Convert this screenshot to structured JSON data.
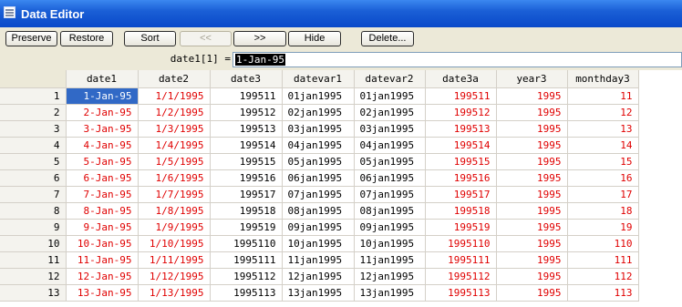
{
  "window": {
    "title": "Data Editor"
  },
  "toolbar": {
    "preserve": "Preserve",
    "restore": "Restore",
    "sort": "Sort",
    "prev": "<<",
    "next": ">>",
    "hide": "Hide",
    "delete": "Delete..."
  },
  "expression": {
    "label": "date1[1] =",
    "value": "1-Jan-95"
  },
  "columns": [
    "date1",
    "date2",
    "date3",
    "datevar1",
    "datevar2",
    "date3a",
    "year3",
    "monthday3"
  ],
  "rows": [
    {
      "n": "1",
      "c": [
        "1-Jan-95",
        "1/1/1995",
        "199511",
        "01jan1995",
        "01jan1995",
        "199511",
        "1995",
        "11"
      ]
    },
    {
      "n": "2",
      "c": [
        "2-Jan-95",
        "1/2/1995",
        "199512",
        "02jan1995",
        "02jan1995",
        "199512",
        "1995",
        "12"
      ]
    },
    {
      "n": "3",
      "c": [
        "3-Jan-95",
        "1/3/1995",
        "199513",
        "03jan1995",
        "03jan1995",
        "199513",
        "1995",
        "13"
      ]
    },
    {
      "n": "4",
      "c": [
        "4-Jan-95",
        "1/4/1995",
        "199514",
        "04jan1995",
        "04jan1995",
        "199514",
        "1995",
        "14"
      ]
    },
    {
      "n": "5",
      "c": [
        "5-Jan-95",
        "1/5/1995",
        "199515",
        "05jan1995",
        "05jan1995",
        "199515",
        "1995",
        "15"
      ]
    },
    {
      "n": "6",
      "c": [
        "6-Jan-95",
        "1/6/1995",
        "199516",
        "06jan1995",
        "06jan1995",
        "199516",
        "1995",
        "16"
      ]
    },
    {
      "n": "7",
      "c": [
        "7-Jan-95",
        "1/7/1995",
        "199517",
        "07jan1995",
        "07jan1995",
        "199517",
        "1995",
        "17"
      ]
    },
    {
      "n": "8",
      "c": [
        "8-Jan-95",
        "1/8/1995",
        "199518",
        "08jan1995",
        "08jan1995",
        "199518",
        "1995",
        "18"
      ]
    },
    {
      "n": "9",
      "c": [
        "9-Jan-95",
        "1/9/1995",
        "199519",
        "09jan1995",
        "09jan1995",
        "199519",
        "1995",
        "19"
      ]
    },
    {
      "n": "10",
      "c": [
        "10-Jan-95",
        "1/10/1995",
        "1995110",
        "10jan1995",
        "10jan1995",
        "1995110",
        "1995",
        "110"
      ]
    },
    {
      "n": "11",
      "c": [
        "11-Jan-95",
        "1/11/1995",
        "1995111",
        "11jan1995",
        "11jan1995",
        "1995111",
        "1995",
        "111"
      ]
    },
    {
      "n": "12",
      "c": [
        "12-Jan-95",
        "1/12/1995",
        "1995112",
        "12jan1995",
        "12jan1995",
        "1995112",
        "1995",
        "112"
      ]
    },
    {
      "n": "13",
      "c": [
        "13-Jan-95",
        "1/13/1995",
        "1995113",
        "13jan1995",
        "13jan1995",
        "1995113",
        "1995",
        "113"
      ]
    }
  ],
  "colors": {
    "string": "#e00000",
    "numeric": "#000000",
    "selection": "#3169c6"
  }
}
